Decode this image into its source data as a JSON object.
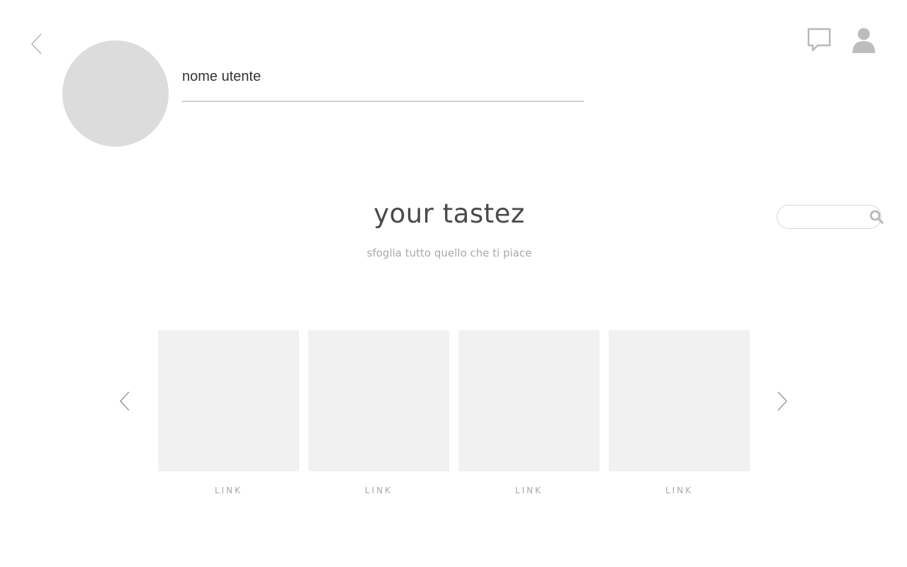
{
  "header": {
    "username": "nome utente"
  },
  "hero": {
    "title": "your tastez",
    "subtitle": "sfoglia tutto quello che ti piace"
  },
  "search": {
    "value": ""
  },
  "carousel": {
    "cards": [
      {
        "link_label": "LINK"
      },
      {
        "link_label": "LINK"
      },
      {
        "link_label": "LINK"
      },
      {
        "link_label": "LINK"
      }
    ]
  },
  "icons": {
    "back": "chevron-left-icon",
    "messages": "chat-bubble-icon",
    "profile": "user-icon",
    "search": "search-icon",
    "carousel_prev": "chevron-left-icon",
    "carousel_next": "chevron-right-icon"
  },
  "colors": {
    "placeholder": "#dcdcdc",
    "card_background": "#f1f1f1",
    "icon_gray": "#bdbdbd",
    "title_text": "#4a4a4a",
    "muted_text": "#a9a9a9"
  }
}
